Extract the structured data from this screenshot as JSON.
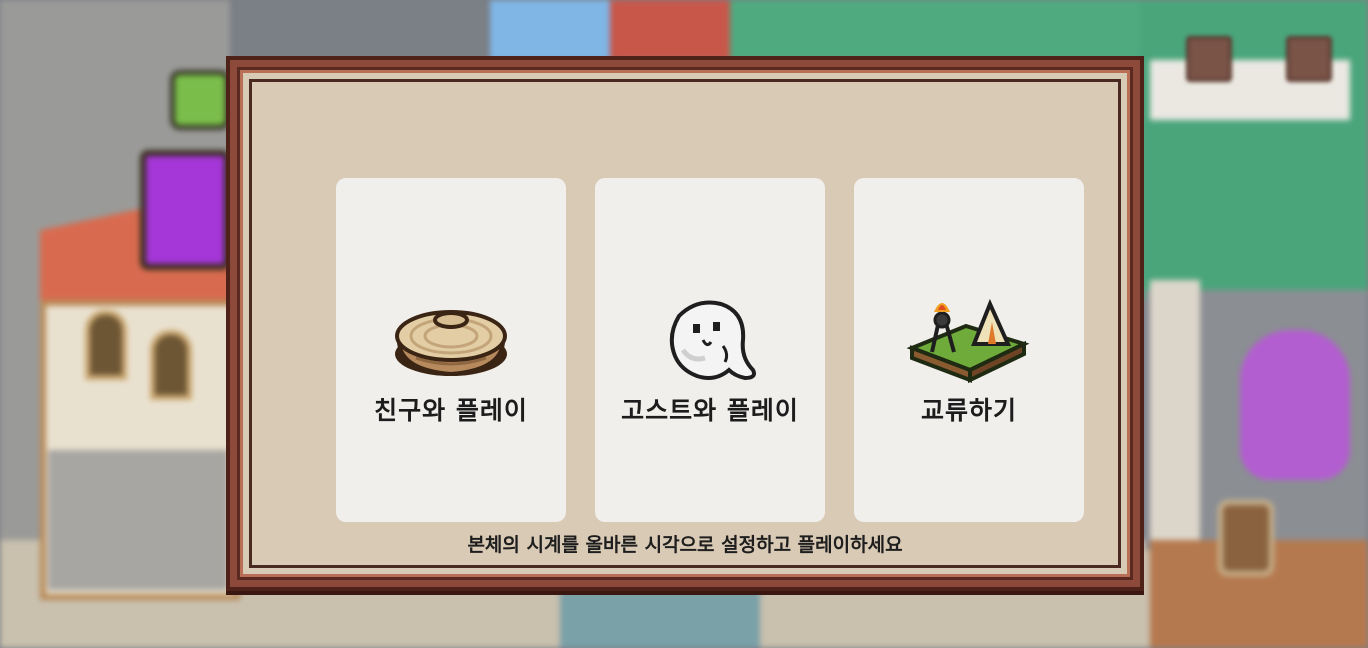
{
  "menu": {
    "options": [
      {
        "label": "친구와 플레이",
        "icon": "pot-icon"
      },
      {
        "label": "고스트와 플레이",
        "icon": "ghost-icon"
      },
      {
        "label": "교류하기",
        "icon": "campsite-icon"
      }
    ]
  },
  "notice": "본체의 시계를 올바른 시각으로 설정하고 플레이하세요",
  "colors": {
    "frame_outer": "#8d4a3a",
    "frame_panel": "#d9cab5",
    "card_bg": "#f1efec",
    "text": "#1c1c1c"
  }
}
